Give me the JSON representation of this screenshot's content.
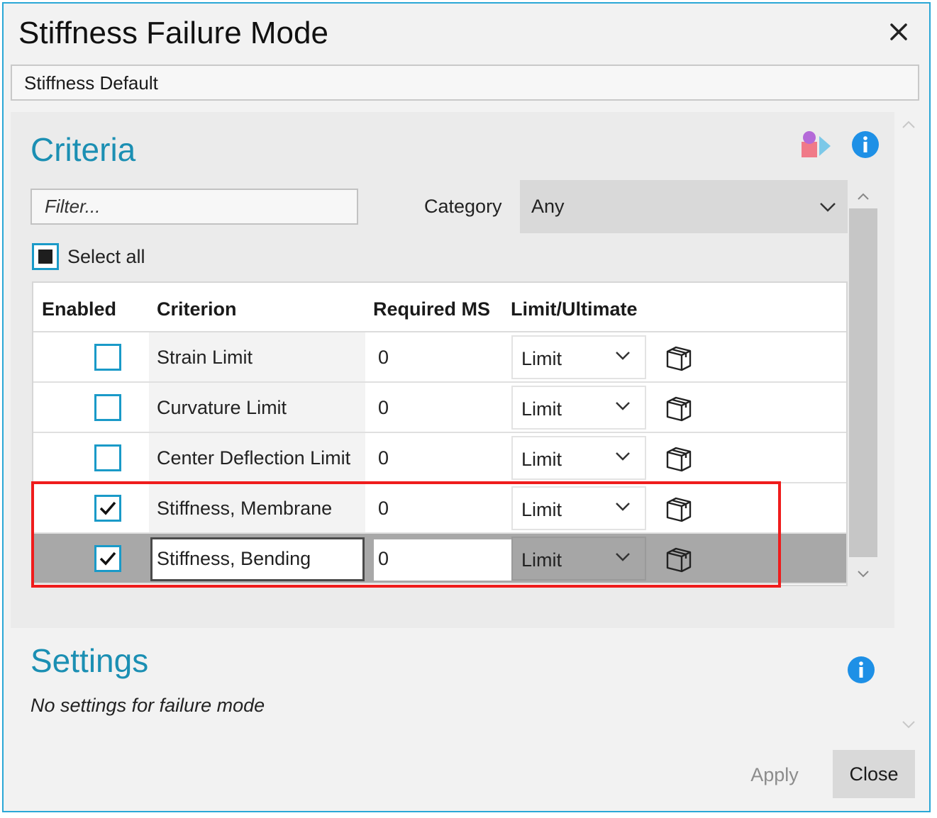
{
  "window": {
    "title": "Stiffness Failure Mode",
    "close_icon": "close-icon"
  },
  "name_field": {
    "value": "Stiffness Default"
  },
  "criteria": {
    "title": "Criteria",
    "filter_placeholder": "Filter...",
    "category_label": "Category",
    "category_value": "Any",
    "select_all_label": "Select all",
    "columns": [
      "Enabled",
      "Criterion",
      "Required MS",
      "Limit/Ultimate"
    ],
    "rows": [
      {
        "enabled": false,
        "criterion": "Strain Limit",
        "required_ms": "0",
        "limit": "Limit"
      },
      {
        "enabled": false,
        "criterion": "Curvature Limit",
        "required_ms": "0",
        "limit": "Limit"
      },
      {
        "enabled": false,
        "criterion": "Center Deflection Limit",
        "required_ms": "0",
        "limit": "Limit"
      },
      {
        "enabled": true,
        "criterion": "Stiffness, Membrane",
        "required_ms": "0",
        "limit": "Limit"
      },
      {
        "enabled": true,
        "criterion": "Stiffness, Bending",
        "required_ms": "0",
        "limit": "Limit",
        "selected": true
      }
    ],
    "highlight_color": "#ef1c1c"
  },
  "settings": {
    "title": "Settings",
    "note": "No settings for failure mode"
  },
  "footer": {
    "apply_label": "Apply",
    "close_label": "Close"
  },
  "colors": {
    "accent": "#1b8fb3",
    "info_blue": "#1e90e6",
    "checkbox_border": "#1a9ac8"
  }
}
